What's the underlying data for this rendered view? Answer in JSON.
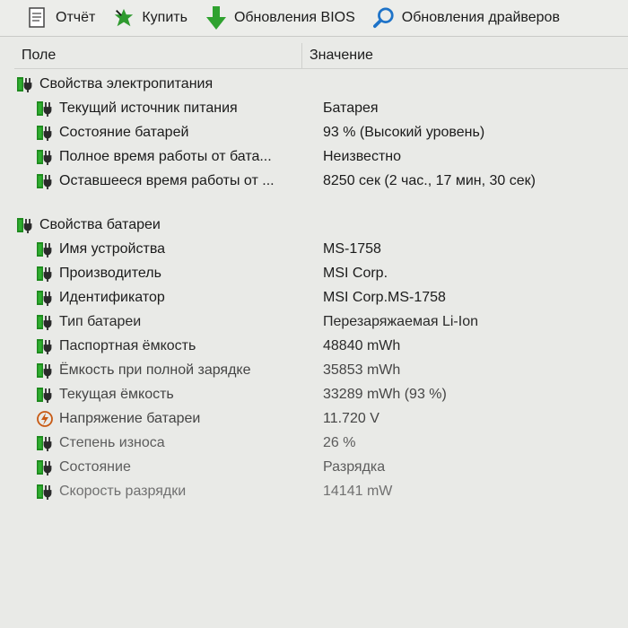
{
  "toolbar": {
    "report_label": "Отчёт",
    "buy_label": "Купить",
    "bios_label": "Обновления BIOS",
    "drivers_label": "Обновления драйверов"
  },
  "columns": {
    "field": "Поле",
    "value": "Значение"
  },
  "groups": [
    {
      "title": "Свойства электропитания",
      "items": [
        {
          "field": "Текущий источник питания",
          "value": "Батарея"
        },
        {
          "field": "Состояние батарей",
          "value": "93 % (Высокий уровень)"
        },
        {
          "field": "Полное время работы от бата...",
          "value": "Неизвестно"
        },
        {
          "field": "Оставшееся время работы от ...",
          "value": "8250 сек (2 час., 17 мин, 30 сек)"
        }
      ]
    },
    {
      "title": "Свойства батареи",
      "items": [
        {
          "field": "Имя устройства",
          "value": "MS-1758"
        },
        {
          "field": "Производитель",
          "value": "MSI Corp."
        },
        {
          "field": "Идентификатор",
          "value": "MSI Corp.MS-1758"
        },
        {
          "field": "Тип батареи",
          "value": "Перезаряжаемая Li-Ion"
        },
        {
          "field": "Паспортная ёмкость",
          "value": "48840 mWh"
        },
        {
          "field": "Ёмкость при полной зарядке",
          "value": "35853 mWh"
        },
        {
          "field": "Текущая ёмкость",
          "value": "33289 mWh  (93 %)"
        },
        {
          "field": "Напряжение батареи",
          "value": "11.720 V"
        },
        {
          "field": "Степень износа",
          "value": "26 %"
        },
        {
          "field": "Состояние",
          "value": "Разрядка"
        },
        {
          "field": "Скорость разрядки",
          "value": "14141 mW"
        }
      ]
    }
  ],
  "icons": {
    "battery_color": "#1f8a1f",
    "plug_color": "#2b2b2b",
    "voltage_color": "#c85a14",
    "search_color": "#1e73c8"
  }
}
